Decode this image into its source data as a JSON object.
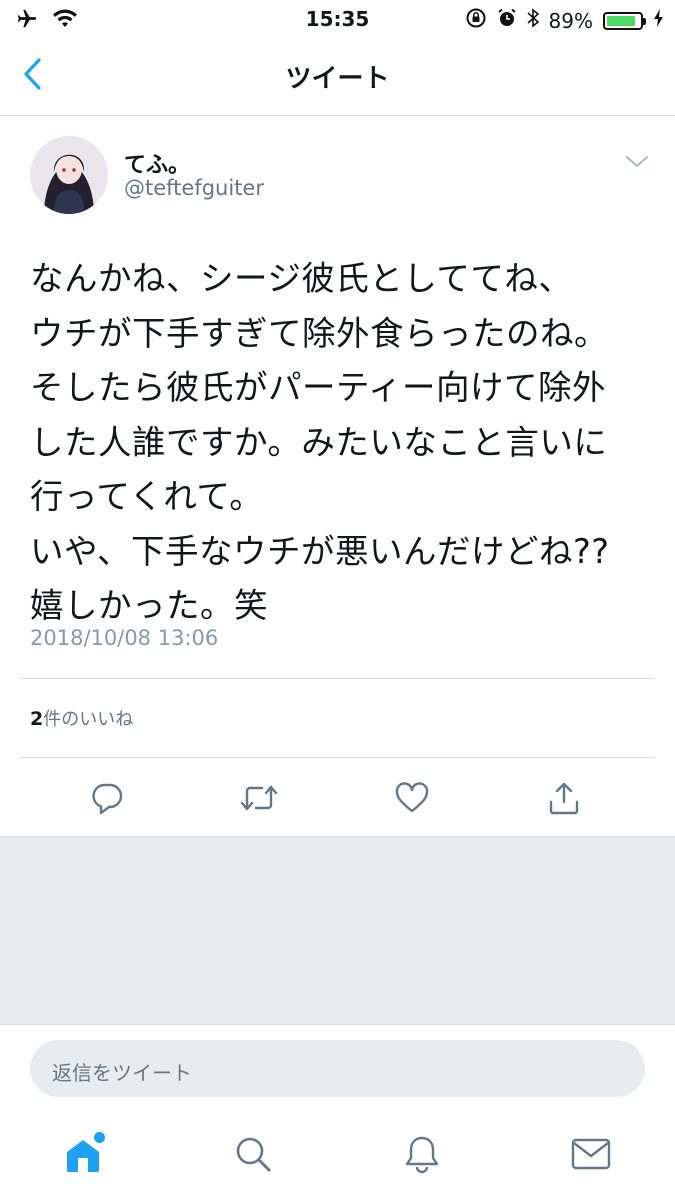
{
  "status_bar": {
    "time": "15:35",
    "battery_percent": "89%",
    "battery_level": 0.89,
    "icons": [
      "airplane-icon",
      "wifi-icon",
      "orientation-lock-icon",
      "alarm-icon",
      "bluetooth-icon",
      "battery-icon",
      "charging-icon"
    ]
  },
  "nav": {
    "title": "ツイート",
    "back_icon": "chevron-left-icon"
  },
  "tweet": {
    "display_name": "てふ。",
    "username": "@teftefguiter",
    "text": "なんかね、シージ彼氏としててね、\nウチが下手すぎて除外食らったのね。\nそしたら彼氏がパーティー向けて除外\nした人誰ですか。みたいなこと言いに\n行ってくれて。\nいや、下手なウチが悪いんだけどね??\n嬉しかった。笑",
    "timestamp": "2018/10/08 13:06",
    "likes_count": "2",
    "likes_label": "件のいいね"
  },
  "actions": [
    "reply-icon",
    "retweet-icon",
    "like-icon",
    "share-icon"
  ],
  "reply": {
    "placeholder": "返信をツイート"
  },
  "tabs": [
    "home-icon",
    "search-icon",
    "notifications-icon",
    "messages-icon"
  ],
  "colors": {
    "accent": "#1da1f2",
    "secondary_text": "#657786",
    "divider": "#d7dde2",
    "gray_bg": "#e6ecf0"
  }
}
